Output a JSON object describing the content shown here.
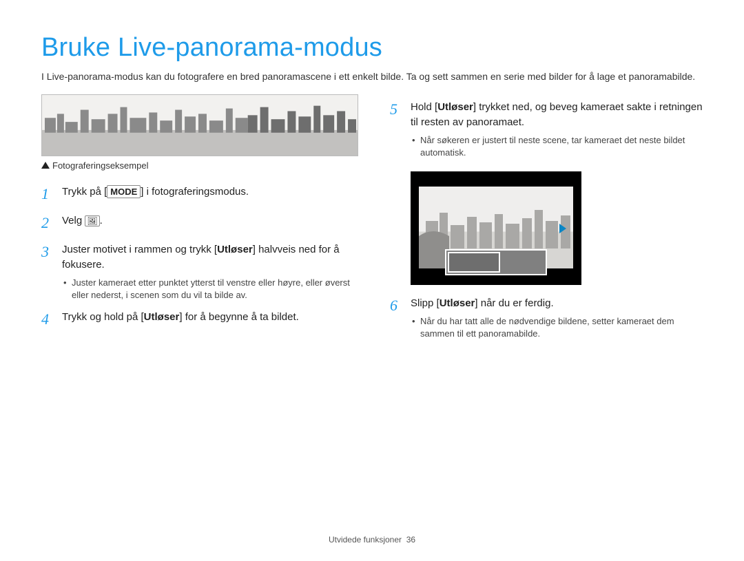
{
  "title": "Bruke Live-panorama-modus",
  "intro": "I Live-panorama-modus kan du fotografere en bred panoramascene i ett enkelt bilde. Ta og sett sammen en serie med bilder for å lage et panoramabilde.",
  "example_caption": "Fotograferingseksempel",
  "steps_left": [
    {
      "num": "1",
      "pre": "Trykk på [",
      "mode_label": "MODE",
      "post": "] i fotograferingsmodus."
    },
    {
      "num": "2",
      "text": "Velg ",
      "icon_name": "panorama-mode-icon",
      "post": "."
    },
    {
      "num": "3",
      "text_parts": [
        "Juster motivet i rammen og trykk [",
        "Utløser",
        "] halvveis ned for å fokusere."
      ],
      "sub": [
        "Juster kameraet etter punktet ytterst til venstre eller høyre, eller øverst eller nederst, i scenen som du vil ta bilde av."
      ]
    },
    {
      "num": "4",
      "text_parts": [
        "Trykk og hold på [",
        "Utløser",
        "] for å begynne å ta bildet."
      ]
    }
  ],
  "steps_right": [
    {
      "num": "5",
      "text_parts": [
        "Hold [",
        "Utløser",
        "] trykket ned, og beveg kameraet sakte i retningen til resten av panoramaet."
      ],
      "sub": [
        "Når søkeren er justert til neste scene, tar kameraet det neste bildet automatisk."
      ]
    },
    {
      "num": "6",
      "text_parts": [
        "Slipp [",
        "Utløser",
        "] når du er ferdig."
      ],
      "sub": [
        "Når du har tatt alle de nødvendige bildene, setter kameraet dem sammen til ett panoramabilde."
      ]
    }
  ],
  "footer_section": "Utvidede funksjoner",
  "footer_page": "36"
}
